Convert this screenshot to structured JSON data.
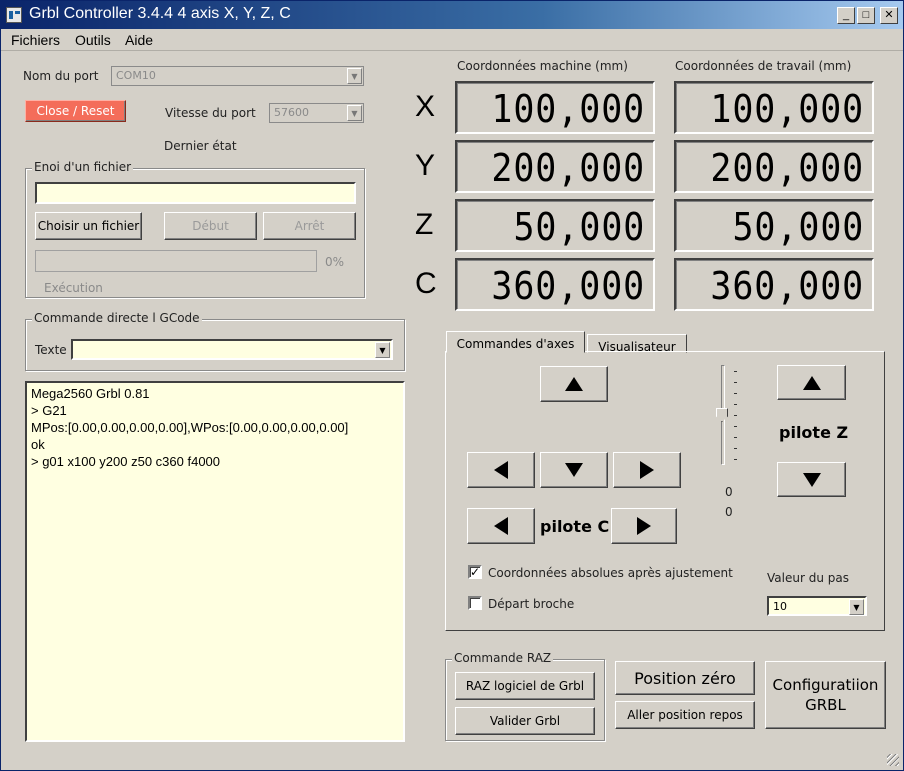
{
  "window": {
    "title": "Grbl Controller 3.4.4 4 axis X, Y, Z, C",
    "minimize": "_",
    "maximize": "□",
    "close": "✕"
  },
  "menu": [
    "Fichiers",
    "Outils",
    "Aide"
  ],
  "port": {
    "label": "Nom du port",
    "value": "COM10",
    "close_reset": "Close / Reset",
    "speed_label": "Vitesse du port",
    "speed_value": "57600",
    "last_state": "Dernier état"
  },
  "file_send": {
    "legend": "Enoi d'un fichier",
    "path_value": "",
    "choose": "Choisir un fichier",
    "start": "Début",
    "stop": "Arrêt",
    "progress_percent": "0%",
    "progress_fraction": 0,
    "execution": "Exécution"
  },
  "gcode": {
    "legend": "Commande directe l GCode",
    "text_label": "Texte",
    "value": ""
  },
  "console_lines": [
    "Mega2560 Grbl 0.81",
    "> G21",
    "MPos:[0.00,0.00,0.00,0.00],WPos:[0.00,0.00,0.00,0.00]",
    "ok",
    "> g01 x100 y200 z50 c360 f4000"
  ],
  "coords": {
    "machine_header": "Coordonnées machine  (mm)",
    "work_header": "Coordonnées de travail  (mm)",
    "axes": [
      {
        "letter": "X",
        "machine": "100,000",
        "work": "100,000"
      },
      {
        "letter": "Y",
        "machine": "200,000",
        "work": "200,000"
      },
      {
        "letter": "Z",
        "machine": "50,000",
        "work": "50,000"
      },
      {
        "letter": "C",
        "machine": "360,000",
        "work": "360,000"
      }
    ]
  },
  "tabs": [
    "Commandes d'axes",
    "Visualisateur"
  ],
  "axis_control": {
    "pilot_c": "pilote C",
    "pilot_z": "pilote Z",
    "slider_value_1": "0",
    "slider_value_2": "0",
    "abs_coords": "Coordonnées absolues après ajustement",
    "abs_coords_checked": true,
    "spindle": "Départ broche",
    "spindle_checked": false,
    "step_label": "Valeur du pas",
    "step_value": "10"
  },
  "raz": {
    "legend": "Commande RAZ",
    "raz_grbl": "RAZ logiciel de Grbl",
    "validate": "Valider Grbl"
  },
  "position": {
    "zero": "Position zéro",
    "home": "Aller position repos"
  },
  "config": {
    "line1": "Configuratiion",
    "line2": "GRBL"
  },
  "colors": {
    "accent_red": "#f46d5a",
    "console_bg": "#ffffe1",
    "title_bar": "#0a246a"
  }
}
